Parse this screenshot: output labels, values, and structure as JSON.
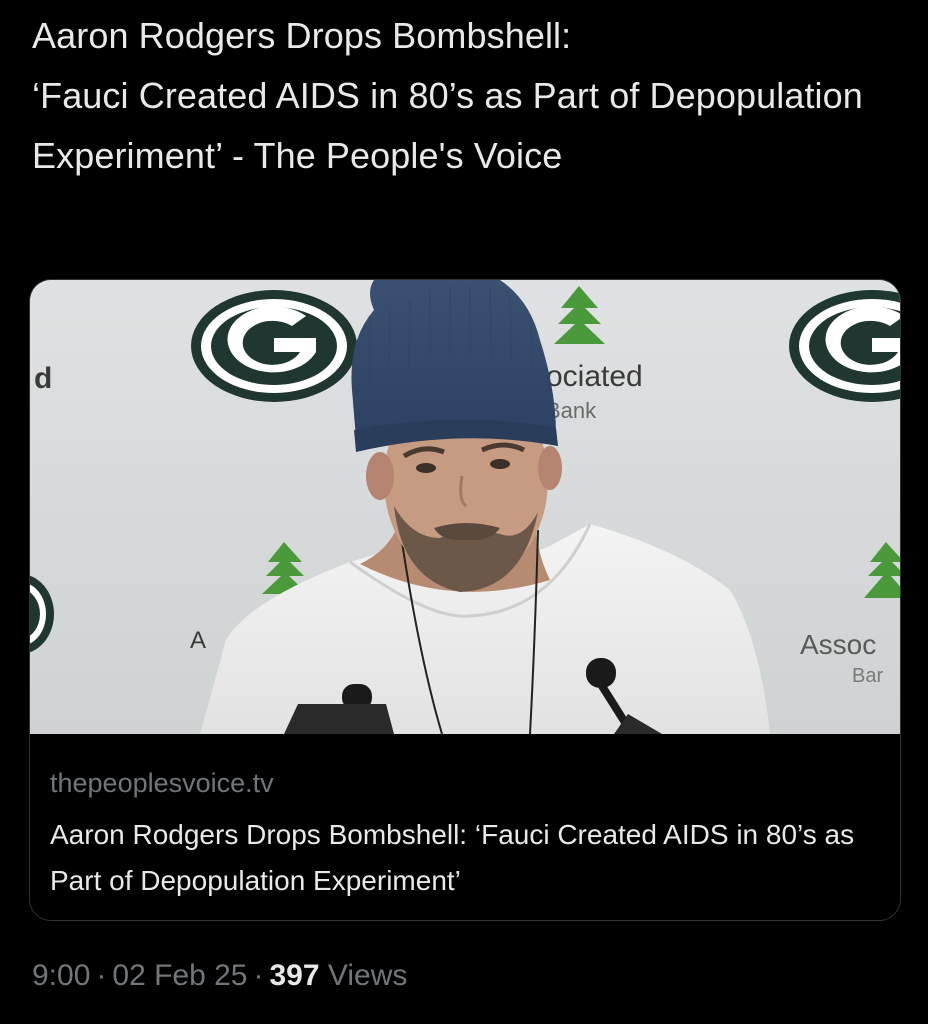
{
  "post": {
    "text": "Aaron Rodgers Drops Bombshell:\n‘Fauci Created AIDS in 80’s as Part of Depopulation Experiment’ - The People's Voice"
  },
  "card": {
    "image_description_icon": "press-conference-photo",
    "backdrop_text": {
      "left_fragment": "d",
      "sponsor_top": "ociated",
      "sponsor_top_sub": "Bank",
      "sponsor_left_fragment": "A",
      "sponsor_right": "Assoc",
      "sponsor_right_sub": "Bar"
    },
    "domain": "thepeoplesvoice.tv",
    "title": "Aaron Rodgers Drops Bombshell: ‘Fauci Created AIDS in 80’s as Part of Depopulation Experiment’"
  },
  "meta": {
    "time": "9:00",
    "separator": "·",
    "date": "02 Feb 25",
    "views_count": "397",
    "views_label": "Views"
  },
  "colors": {
    "background": "#000000",
    "text_primary": "#e7e9ea",
    "text_secondary": "#71767b",
    "card_border": "#2f3336",
    "logo_green": "#203731",
    "logo_gold": "#ffb612",
    "sponsor_green": "#4a9a3c"
  }
}
